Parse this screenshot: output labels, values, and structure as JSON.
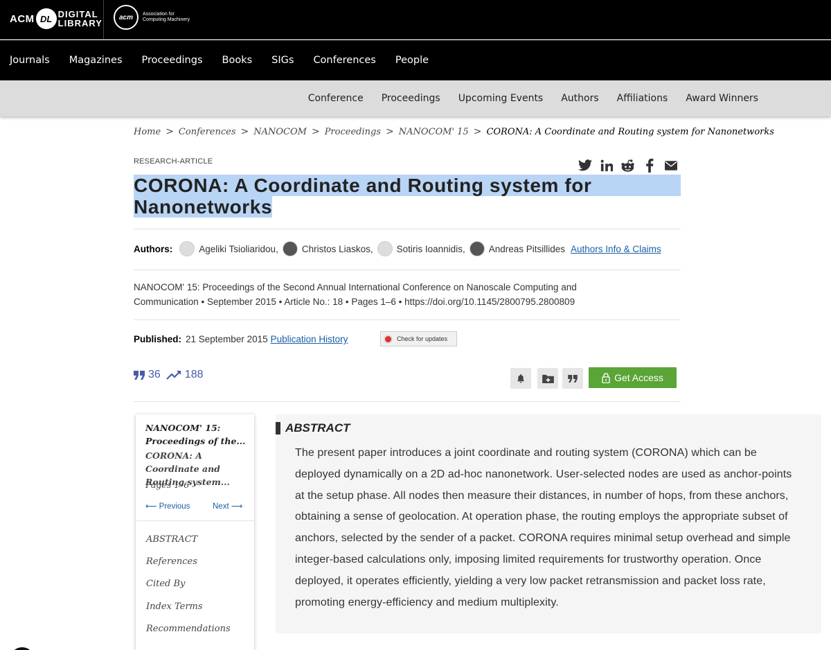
{
  "logos": {
    "acm": "ACM",
    "dl_mark": "DL",
    "digital": "DIGITAL",
    "library": "LIBRARY",
    "acm_seal": "acm",
    "assoc": "Association for Computing Machinery"
  },
  "main_nav": [
    "Journals",
    "Magazines",
    "Proceedings",
    "Books",
    "SIGs",
    "Conferences",
    "People"
  ],
  "sub_nav": [
    "Conference",
    "Proceedings",
    "Upcoming Events",
    "Authors",
    "Affiliations",
    "Award Winners"
  ],
  "breadcrumb": [
    "Home",
    "Conferences",
    "NANOCOM",
    "Proceedings",
    "NANOCOM' 15",
    "CORONA: A Coordinate and Routing system for Nanonetworks"
  ],
  "article_type": "RESEARCH-ARTICLE",
  "share_icons": [
    "twitter-icon",
    "linkedin-icon",
    "reddit-icon",
    "facebook-icon",
    "email-icon"
  ],
  "title_line1": "CORONA: A Coordinate and Routing system for",
  "title_line2": "Nanonetworks",
  "authors_label": "Authors:",
  "authors": [
    "Ageliki Tsioliaridou",
    "Christos Liaskos",
    "Sotiris Ioannidis",
    "Andreas Pitsillides"
  ],
  "authors_claims": "Authors Info & Claims",
  "citation_line1": "NANOCOM' 15: Proceedings of the Second Annual International Conference on Nanoscale Computing and",
  "citation_line2": "Communication • September 2015 • Article No.: 18 • Pages 1–6 • https://doi.org/10.1145/2800795.2800809",
  "published_label": "Published:",
  "published_date": "21 September 2015",
  "publication_history": "Publication History",
  "check_updates": "Check for updates",
  "metrics": {
    "citations": "36",
    "downloads": "188"
  },
  "get_access": "Get Access",
  "left_panel": {
    "proceedings": "NANOCOM' 15: Proceedings of the...",
    "article": "CORONA: A Coordinate and Routing system...",
    "pages": "Pages 1–6",
    "previous": "⟵ Previous",
    "next": "Next ⟶",
    "items": [
      "ABSTRACT",
      "References",
      "Cited By",
      "Index Terms",
      "Recommendations"
    ]
  },
  "abstract": {
    "heading": "ABSTRACT",
    "text": "The present paper introduces a joint coordinate and routing system (CORONA) which can be deployed dynamically on a 2D ad-hoc nanonetwork. User-selected nodes are used as anchor-points at the setup phase. All nodes then measure their distances, in number of hops, from these anchors, obtaining a sense of geolocation. At operation phase, the routing employs the appropriate subset of anchors, selected by the sender of a packet. CORONA requires minimal setup overhead and simple integer-based calculations only, imposing limited requirements for trustworthy operation. Once deployed, it operates efficiently, yielding a very low packet retransmission and packet loss rate, promoting energy-efficiency and medium multiplexity."
  },
  "colors": {
    "link": "#1a5ea8",
    "access": "#5aa536",
    "metric": "#4a5aa8",
    "highlight": "#b9d5f5"
  }
}
